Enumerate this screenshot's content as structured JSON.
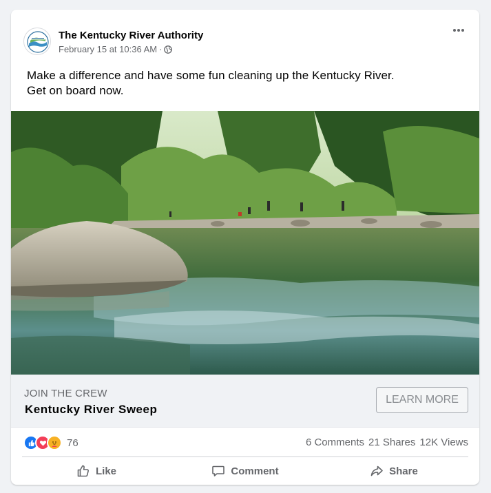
{
  "post": {
    "page_name": "The Kentucky River Authority",
    "date": "February 15 at 10:36 AM",
    "separator": "·",
    "privacy_icon": "globe-icon",
    "options_icon": "more-horiz-icon",
    "avatar_logo_text": "KENTUCKY RIVER",
    "text_line1": "Make a difference and have some fun cleaning up the Kentucky River.",
    "text_line2": "Get on board now."
  },
  "link": {
    "caption": "JOIN THE CREW",
    "title": "Kentucky River Sweep",
    "cta_label": "LEARN MORE"
  },
  "stats": {
    "reaction_icons": [
      "like-reaction-icon",
      "love-reaction-icon",
      "care-reaction-icon"
    ],
    "reaction_count": "76",
    "comments": "6 Comments",
    "shares": "21 Shares",
    "views": "12K Views"
  },
  "actions": {
    "like_label": "Like",
    "comment_label": "Comment",
    "share_label": "Share"
  },
  "colors": {
    "like_blue": "#1877f2",
    "love_red": "#f33e58",
    "care_yellow": "#f7b125",
    "secondary_text": "#65676b",
    "link_box_bg": "#f0f2f5"
  }
}
